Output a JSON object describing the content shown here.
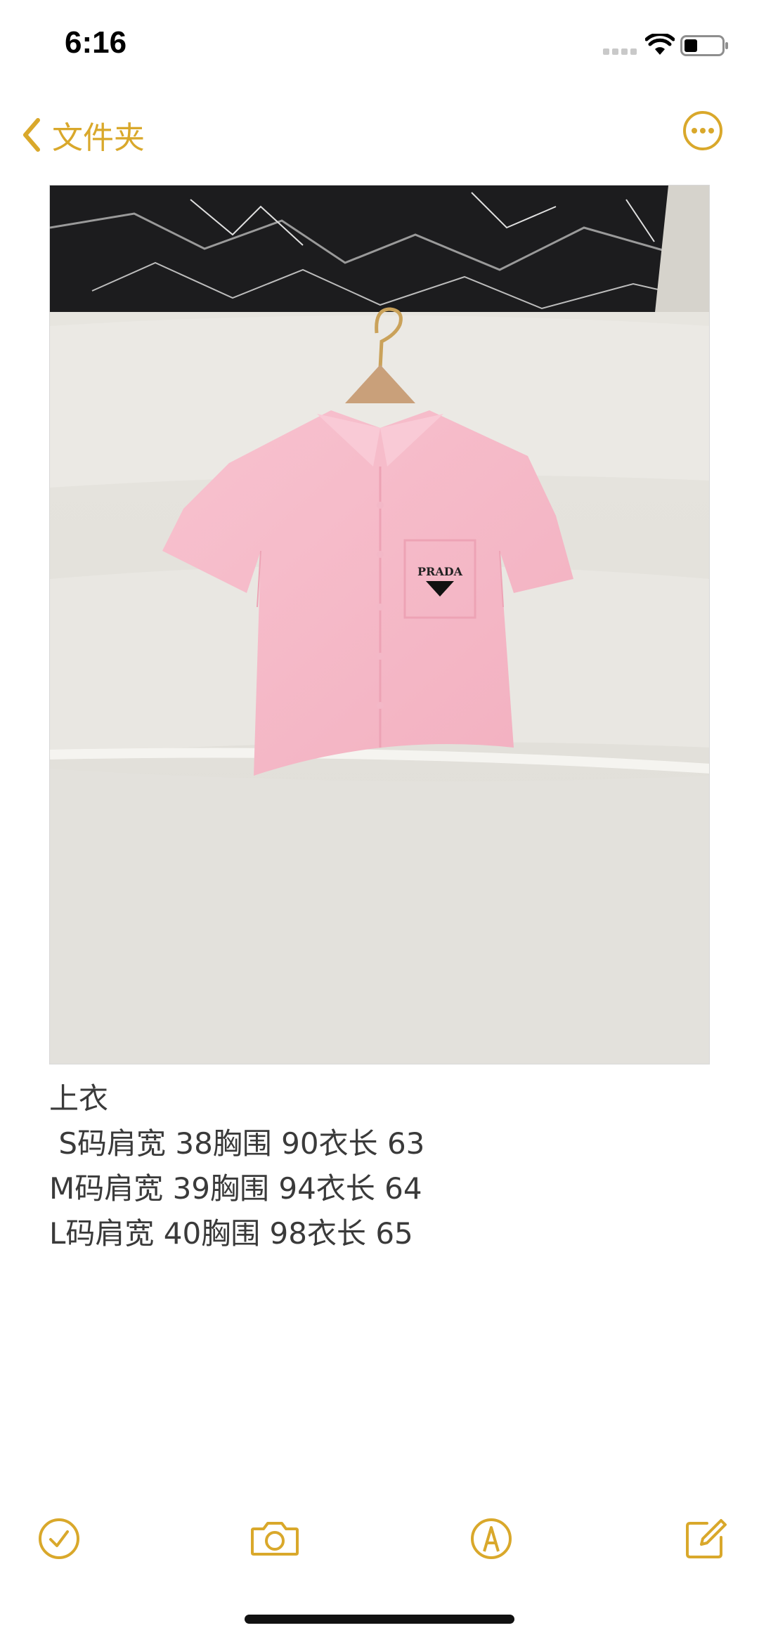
{
  "status_bar": {
    "time": "6:16",
    "icons": [
      "cellular-signal-icon",
      "wifi-icon",
      "battery-icon"
    ]
  },
  "nav": {
    "back_label": "文件夹",
    "back_icon": "chevron-left-icon",
    "more_icon": "more-options-icon"
  },
  "note": {
    "image_alt": "pink short-sleeve shirt with PRADA logo on hanger",
    "image_logo_text": "PRADA",
    "lines": [
      "上衣",
      " S码肩宽 38胸围 90衣长 63",
      "M码肩宽 39胸围 94衣长 64",
      "L码肩宽 40胸围 98衣长 65"
    ]
  },
  "toolbar": {
    "items": [
      "checklist-icon",
      "camera-icon",
      "markup-icon",
      "compose-icon"
    ]
  },
  "colors": {
    "accent": "#d9a82b",
    "text": "#3a3a3a",
    "shirt": "#f6b8c8"
  }
}
